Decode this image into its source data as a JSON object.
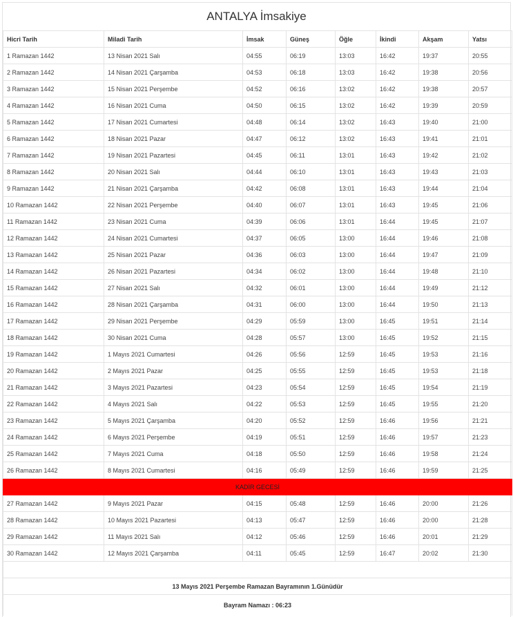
{
  "title": "ANTALYA İmsakiye",
  "headers": [
    "Hicri Tarih",
    "Miladi Tarih",
    "İmsak",
    "Güneş",
    "Öğle",
    "İkindi",
    "Akşam",
    "Yatsı"
  ],
  "rows_before": [
    [
      "1 Ramazan 1442",
      "13 Nisan 2021 Salı",
      "04:55",
      "06:19",
      "13:03",
      "16:42",
      "19:37",
      "20:55"
    ],
    [
      "2 Ramazan 1442",
      "14 Nisan 2021 Çarşamba",
      "04:53",
      "06:18",
      "13:03",
      "16:42",
      "19:38",
      "20:56"
    ],
    [
      "3 Ramazan 1442",
      "15 Nisan 2021 Perşembe",
      "04:52",
      "06:16",
      "13:02",
      "16:42",
      "19:38",
      "20:57"
    ],
    [
      "4 Ramazan 1442",
      "16 Nisan 2021 Cuma",
      "04:50",
      "06:15",
      "13:02",
      "16:42",
      "19:39",
      "20:59"
    ],
    [
      "5 Ramazan 1442",
      "17 Nisan 2021 Cumartesi",
      "04:48",
      "06:14",
      "13:02",
      "16:43",
      "19:40",
      "21:00"
    ],
    [
      "6 Ramazan 1442",
      "18 Nisan 2021 Pazar",
      "04:47",
      "06:12",
      "13:02",
      "16:43",
      "19:41",
      "21:01"
    ],
    [
      "7 Ramazan 1442",
      "19 Nisan 2021 Pazartesi",
      "04:45",
      "06:11",
      "13:01",
      "16:43",
      "19:42",
      "21:02"
    ],
    [
      "8 Ramazan 1442",
      "20 Nisan 2021 Salı",
      "04:44",
      "06:10",
      "13:01",
      "16:43",
      "19:43",
      "21:03"
    ],
    [
      "9 Ramazan 1442",
      "21 Nisan 2021 Çarşamba",
      "04:42",
      "06:08",
      "13:01",
      "16:43",
      "19:44",
      "21:04"
    ],
    [
      "10 Ramazan 1442",
      "22 Nisan 2021 Perşembe",
      "04:40",
      "06:07",
      "13:01",
      "16:43",
      "19:45",
      "21:06"
    ],
    [
      "11 Ramazan 1442",
      "23 Nisan 2021 Cuma",
      "04:39",
      "06:06",
      "13:01",
      "16:44",
      "19:45",
      "21:07"
    ],
    [
      "12 Ramazan 1442",
      "24 Nisan 2021 Cumartesi",
      "04:37",
      "06:05",
      "13:00",
      "16:44",
      "19:46",
      "21:08"
    ],
    [
      "13 Ramazan 1442",
      "25 Nisan 2021 Pazar",
      "04:36",
      "06:03",
      "13:00",
      "16:44",
      "19:47",
      "21:09"
    ],
    [
      "14 Ramazan 1442",
      "26 Nisan 2021 Pazartesi",
      "04:34",
      "06:02",
      "13:00",
      "16:44",
      "19:48",
      "21:10"
    ],
    [
      "15 Ramazan 1442",
      "27 Nisan 2021 Salı",
      "04:32",
      "06:01",
      "13:00",
      "16:44",
      "19:49",
      "21:12"
    ],
    [
      "16 Ramazan 1442",
      "28 Nisan 2021 Çarşamba",
      "04:31",
      "06:00",
      "13:00",
      "16:44",
      "19:50",
      "21:13"
    ],
    [
      "17 Ramazan 1442",
      "29 Nisan 2021 Perşembe",
      "04:29",
      "05:59",
      "13:00",
      "16:45",
      "19:51",
      "21:14"
    ],
    [
      "18 Ramazan 1442",
      "30 Nisan 2021 Cuma",
      "04:28",
      "05:57",
      "13:00",
      "16:45",
      "19:52",
      "21:15"
    ],
    [
      "19 Ramazan 1442",
      "1 Mayıs 2021 Cumartesi",
      "04:26",
      "05:56",
      "12:59",
      "16:45",
      "19:53",
      "21:16"
    ],
    [
      "20 Ramazan 1442",
      "2 Mayıs 2021 Pazar",
      "04:25",
      "05:55",
      "12:59",
      "16:45",
      "19:53",
      "21:18"
    ],
    [
      "21 Ramazan 1442",
      "3 Mayıs 2021 Pazartesi",
      "04:23",
      "05:54",
      "12:59",
      "16:45",
      "19:54",
      "21:19"
    ],
    [
      "22 Ramazan 1442",
      "4 Mayıs 2021 Salı",
      "04:22",
      "05:53",
      "12:59",
      "16:45",
      "19:55",
      "21:20"
    ],
    [
      "23 Ramazan 1442",
      "5 Mayıs 2021 Çarşamba",
      "04:20",
      "05:52",
      "12:59",
      "16:46",
      "19:56",
      "21:21"
    ],
    [
      "24 Ramazan 1442",
      "6 Mayıs 2021 Perşembe",
      "04:19",
      "05:51",
      "12:59",
      "16:46",
      "19:57",
      "21:23"
    ],
    [
      "25 Ramazan 1442",
      "7 Mayıs 2021 Cuma",
      "04:18",
      "05:50",
      "12:59",
      "16:46",
      "19:58",
      "21:24"
    ],
    [
      "26 Ramazan 1442",
      "8 Mayıs 2021 Cumartesi",
      "04:16",
      "05:49",
      "12:59",
      "16:46",
      "19:59",
      "21:25"
    ]
  ],
  "special_row": "KADİR GECESİ",
  "special_color": "#ff0000",
  "rows_after": [
    [
      "27 Ramazan 1442",
      "9 Mayıs 2021 Pazar",
      "04:15",
      "05:48",
      "12:59",
      "16:46",
      "20:00",
      "21:26"
    ],
    [
      "28 Ramazan 1442",
      "10 Mayıs 2021 Pazartesi",
      "04:13",
      "05:47",
      "12:59",
      "16:46",
      "20:00",
      "21:28"
    ],
    [
      "29 Ramazan 1442",
      "11 Mayıs 2021 Salı",
      "04:12",
      "05:46",
      "12:59",
      "16:46",
      "20:01",
      "21:29"
    ],
    [
      "30 Ramazan 1442",
      "12 Mayıs 2021 Çarşamba",
      "04:11",
      "05:45",
      "12:59",
      "16:47",
      "20:02",
      "21:30"
    ]
  ],
  "footer": {
    "bayram_note": "13 Mayıs 2021 Perşembe Ramazan Bayramının 1.Günüdür",
    "bayram_namazi": "Bayram Namazı : 06:23"
  }
}
